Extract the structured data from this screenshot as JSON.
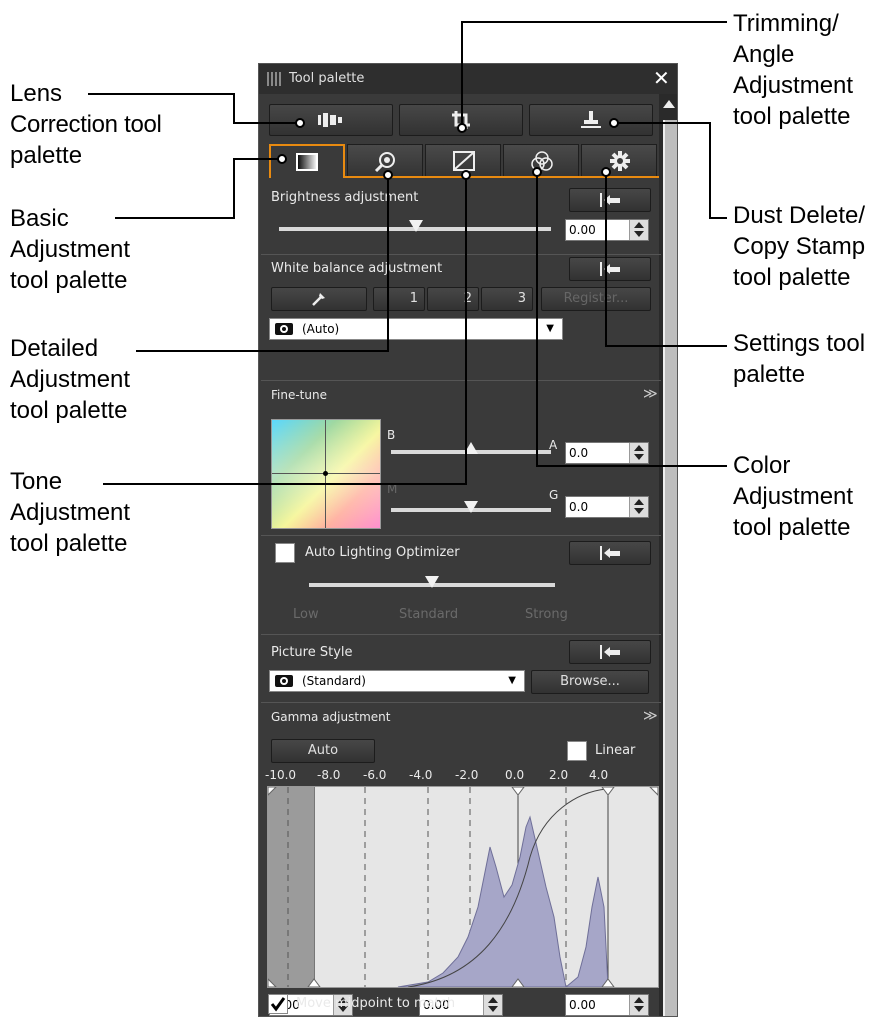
{
  "callouts": {
    "lens": [
      "Lens",
      "Correction tool",
      "palette"
    ],
    "basic": [
      "Basic",
      "Adjustment",
      "tool palette"
    ],
    "detailed": [
      "Detailed",
      "Adjustment",
      "tool palette"
    ],
    "tone": [
      "Tone",
      "Adjustment",
      "tool palette"
    ],
    "trimming": [
      "Trimming/",
      "Angle",
      "Adjustment",
      "tool palette"
    ],
    "dust": [
      "Dust Delete/",
      "Copy Stamp",
      "tool palette"
    ],
    "settings": [
      "Settings tool",
      "palette"
    ],
    "color": [
      "Color",
      "Adjustment",
      "tool palette"
    ]
  },
  "palette": {
    "title": "Tool palette",
    "close": "✕",
    "brightness": {
      "label": "Brightness adjustment",
      "value": "0.00",
      "slider": 0.5
    },
    "white_balance": {
      "label": "White balance adjustment",
      "buttons": [
        "1",
        "2",
        "3"
      ],
      "register": "Register...",
      "preset": "(Auto)"
    },
    "fine_tune": {
      "label": "Fine-tune",
      "b": "B",
      "a": "A",
      "m": "M",
      "g": "G",
      "ba_value": "0.0",
      "mg_value": "0.0"
    },
    "alo": {
      "label": "Auto Lighting Optimizer",
      "low": "Low",
      "standard": "Standard",
      "strong": "Strong"
    },
    "picture_style": {
      "label": "Picture Style",
      "value": "(Standard)",
      "browse": "Browse..."
    },
    "gamma": {
      "label": "Gamma adjustment",
      "auto": "Auto",
      "linear": "Linear",
      "ticks": [
        "-10.0",
        "-8.0",
        "-6.0",
        "-4.0",
        "-2.0",
        "0.0",
        "2.0",
        "4.0"
      ],
      "values": [
        "0.00",
        "0.00",
        "0.00"
      ],
      "midpoint": "Move midpoint to match",
      "midpoint_checked": true
    }
  },
  "colors": {
    "tab_highlight": "#e88a10",
    "panel": "#3a3a3a",
    "histogram": "#a6a6c8"
  }
}
